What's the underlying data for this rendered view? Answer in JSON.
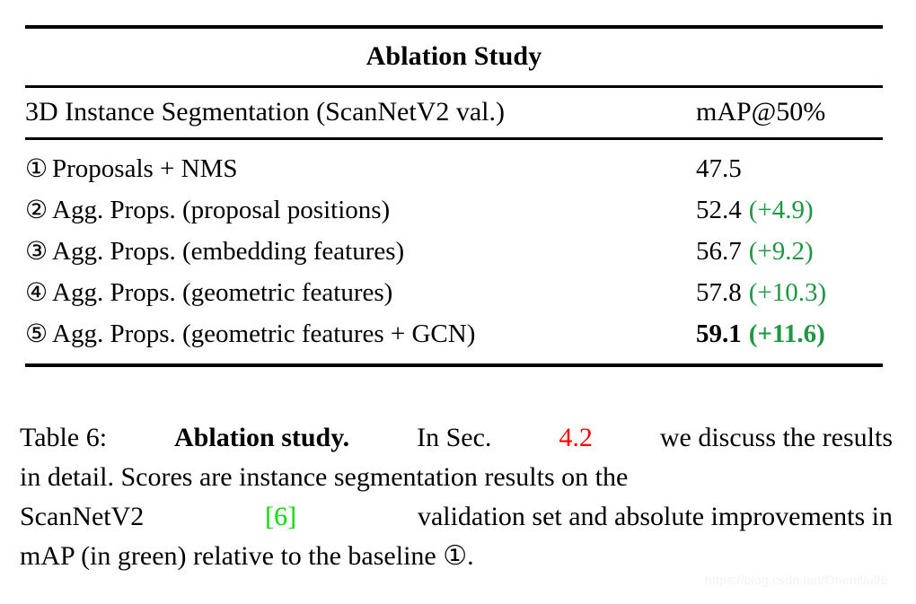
{
  "table": {
    "title": "Ablation Study",
    "columns": {
      "description": "3D Instance Segmentation (ScanNetV2 val.)",
      "metric": "mAP@50%"
    },
    "rows": [
      {
        "marker": "①",
        "label": "Proposals + NMS",
        "score": "47.5",
        "delta": ""
      },
      {
        "marker": "②",
        "label": "Agg. Props. (proposal positions)",
        "score": "52.4",
        "delta": "(+4.9)"
      },
      {
        "marker": "③",
        "label": "Agg. Props. (embedding features)",
        "score": "56.7",
        "delta": "(+9.2)"
      },
      {
        "marker": "④",
        "label": "Agg. Props. (geometric features)",
        "score": "57.8",
        "delta": "(+10.3)"
      },
      {
        "marker": "⑤",
        "label": "Agg. Props. (geometric features + GCN)",
        "score": "59.1",
        "delta": "(+11.6)"
      }
    ]
  },
  "caption": {
    "line1_label": "Table 6:",
    "line1_bold": "Ablation study.",
    "line1_a": "In Sec.",
    "line1_ref": "4.2",
    "line1_b": "we discuss the results",
    "line2": "in detail.  Scores are instance segmentation results on the",
    "line3_a": "ScanNetV2",
    "line3_ref": "[6]",
    "line3_b": "validation set and absolute improvements in",
    "line4": "mAP (in green) relative to the baseline ①."
  },
  "watermark": "https://blog.csdn.net/Orientliu96",
  "colors": {
    "text": "#000000",
    "delta_green": "#1a9940",
    "citation_green": "#00e000",
    "section_ref_red": "#ff0000",
    "watermark": "#f2f2f2"
  }
}
